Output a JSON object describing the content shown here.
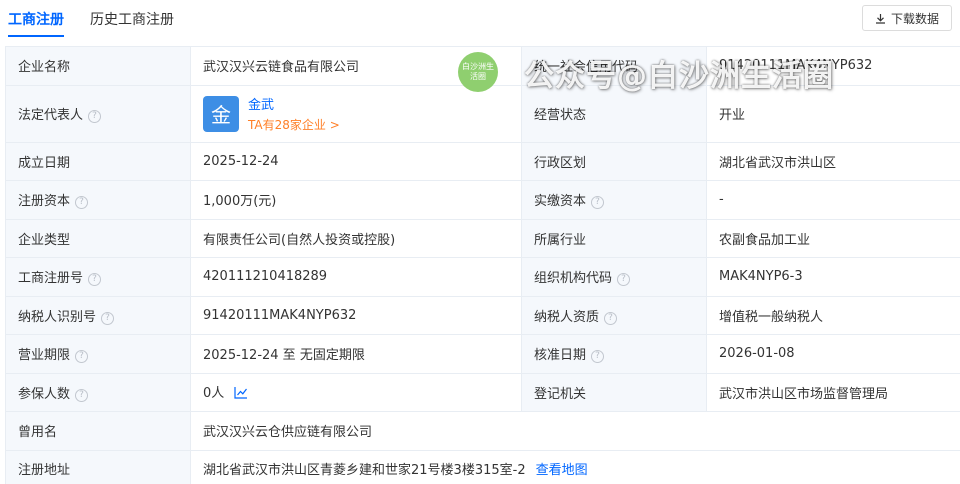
{
  "tabs": [
    {
      "label": "工商注册",
      "active": true
    },
    {
      "label": "历史工商注册",
      "active": false
    }
  ],
  "download_label": "下载数据",
  "company": {
    "name_label": "企业名称",
    "name": "武汉汉兴云链食品有限公司",
    "credit_code_label": "统一社会信用代码",
    "credit_code": "91420111MAK4NYP632",
    "legal_rep_label": "法定代表人",
    "legal_rep_avatar": "金",
    "legal_rep_name": "金武",
    "legal_rep_count": "TA有28家企业 >",
    "status_label": "经营状态",
    "status": "开业",
    "founded_label": "成立日期",
    "founded": "2025-12-24",
    "region_label": "行政区划",
    "region": "湖北省武汉市洪山区",
    "reg_capital_label": "注册资本",
    "reg_capital": "1,000万(元)",
    "paid_capital_label": "实缴资本",
    "paid_capital": "-",
    "type_label": "企业类型",
    "type": "有限责任公司(自然人投资或控股)",
    "industry_label": "所属行业",
    "industry": "农副食品加工业",
    "reg_no_label": "工商注册号",
    "reg_no": "420111210418289",
    "org_code_label": "组织机构代码",
    "org_code": "MAK4NYP6-3",
    "taxpayer_id_label": "纳税人识别号",
    "taxpayer_id": "91420111MAK4NYP632",
    "taxpayer_qual_label": "纳税人资质",
    "taxpayer_qual": "增值税一般纳税人",
    "term_label": "营业期限",
    "term": "2025-12-24 至 无固定期限",
    "approval_label": "核准日期",
    "approval": "2026-01-08",
    "insured_label": "参保人数",
    "insured": "0人",
    "authority_label": "登记机关",
    "authority": "武汉市洪山区市场监督管理局",
    "former_name_label": "曾用名",
    "former_name": "武汉汉兴云仓供应链有限公司",
    "address_label": "注册地址",
    "address": "湖北省武汉市洪山区青菱乡建和世家21号楼3楼315室-2",
    "address_map_link": "查看地图"
  },
  "watermark": {
    "badge_text": "白沙洲生活圈",
    "text": "公众号@白沙洲生活圈"
  },
  "icons": {
    "help": "question-circle-icon",
    "download": "download-icon",
    "trend": "trend-chart-icon"
  },
  "colors": {
    "accent": "#0066ff",
    "orange": "#ff7f27",
    "label_bg": "#f5f8fc",
    "avatar_bg": "#3d8ee5",
    "watermark_green": "#8fcf6f"
  }
}
